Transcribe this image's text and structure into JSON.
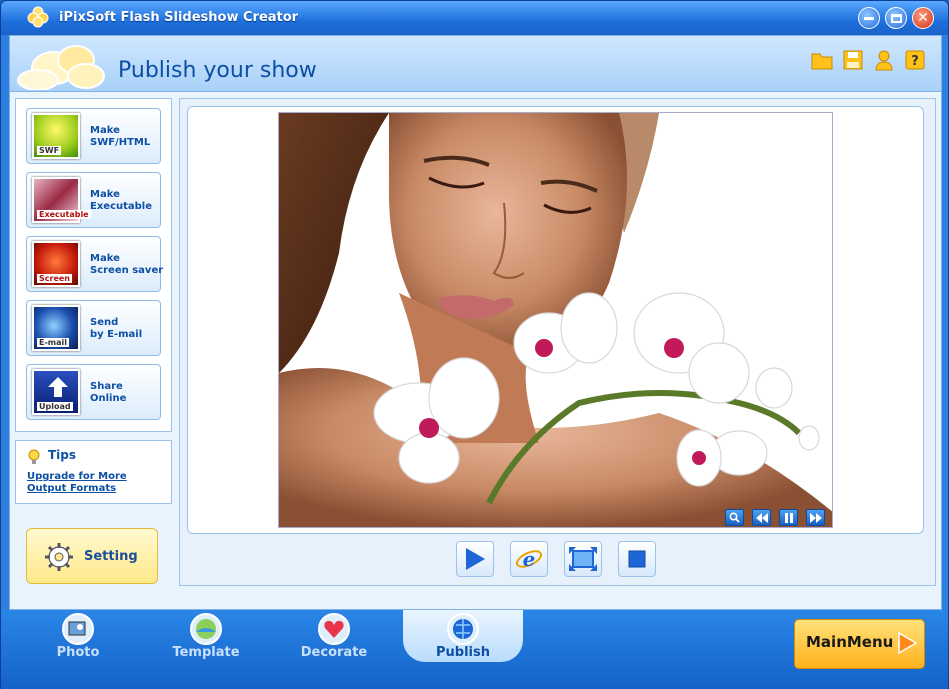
{
  "window": {
    "title": "iPixSoft Flash Slideshow Creator"
  },
  "header": {
    "title": "Publish your show"
  },
  "publish_options": [
    {
      "label": "Make\nSWF/HTML",
      "tag": "SWF"
    },
    {
      "label": "Make\nExecutable",
      "tag": "Executable"
    },
    {
      "label": "Make\nScreen saver",
      "tag": "Screen"
    },
    {
      "label": "Send\nby E-mail",
      "tag": "E-mail"
    },
    {
      "label": "Share\nOnline",
      "tag": "Upload"
    }
  ],
  "tips": {
    "title": "Tips",
    "link": "Upgrade for More Output Formats"
  },
  "setting": {
    "label": "Setting"
  },
  "nav": {
    "tabs": [
      {
        "label": "Photo"
      },
      {
        "label": "Template"
      },
      {
        "label": "Decorate"
      },
      {
        "label": "Publish"
      }
    ],
    "active": "Publish"
  },
  "mainmenu": {
    "label": "MainMenu"
  },
  "colors": {
    "accent": "#0d4fa5",
    "titlebar": "#1e6fdc",
    "mainmenu": "#ffb21c"
  },
  "icons": [
    "app-logo-icon",
    "folder-icon",
    "save-icon",
    "user-icon",
    "help-icon",
    "lightbulb-icon",
    "gear-icon",
    "zoom-icon",
    "prev-icon",
    "pause-icon",
    "next-icon",
    "play-icon",
    "browser-icon",
    "fullscreen-icon",
    "stop-icon"
  ]
}
